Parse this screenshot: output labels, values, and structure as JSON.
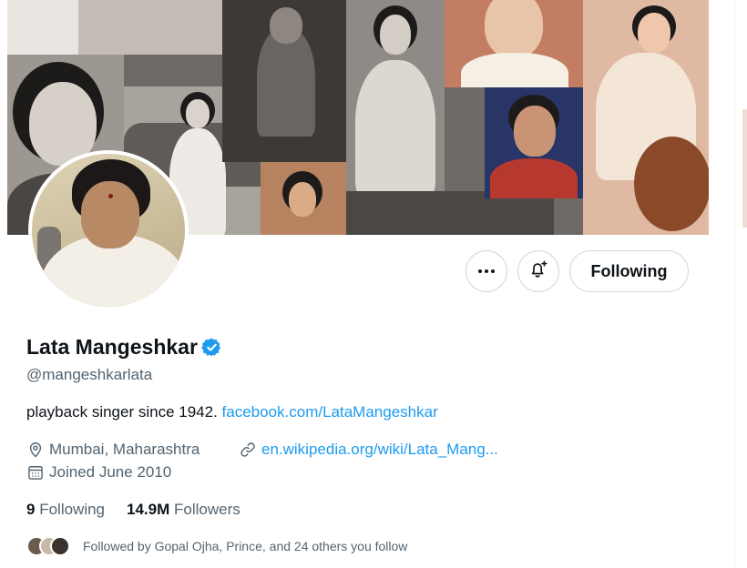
{
  "profile": {
    "name": "Lata Mangeshkar",
    "handle": "@mangeshkarlata",
    "bio_text": "playback singer since 1942. ",
    "bio_link": "facebook.com/LataMangeshkar",
    "location": "Mumbai, Maharashtra",
    "website": "en.wikipedia.org/wiki/Lata_Mang...",
    "joined": "Joined June 2010",
    "verified": true
  },
  "actions": {
    "more_icon": "more-dots-icon",
    "notify_icon": "bell-plus-icon",
    "follow_label": "Following"
  },
  "stats": {
    "following_count": "9",
    "following_label": "Following",
    "followers_count": "14.9M",
    "followers_label": "Followers"
  },
  "followed_by": {
    "text": "Followed by Gopal Ojha, Prince, and 24 others you follow"
  },
  "colors": {
    "accent": "#1d9bf0",
    "text_primary": "#0f1419",
    "text_secondary": "#536471",
    "border": "#cfd9de"
  }
}
